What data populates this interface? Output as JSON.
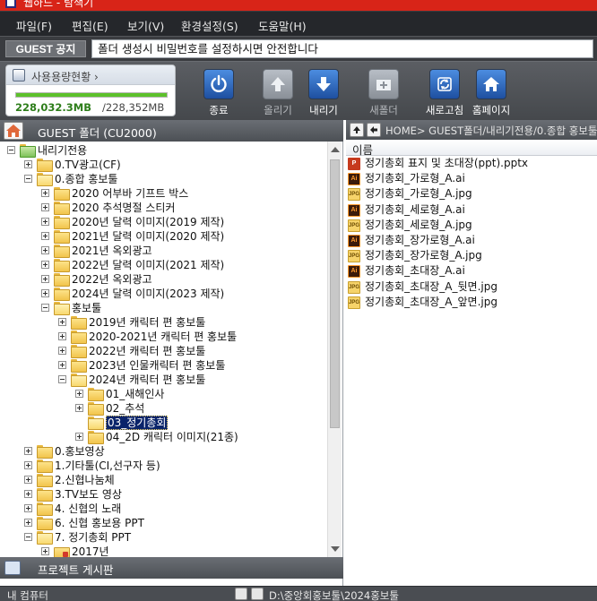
{
  "window": {
    "title": "웹하드 - 탐색기"
  },
  "menu": [
    "파일(F)",
    "편집(E)",
    "보기(V)",
    "환경설정(S)",
    "도움말(H)"
  ],
  "notice": {
    "badge": "GUEST 공지",
    "text": "폴더 생성시 비밀번호를 설정하시면 안전합니다"
  },
  "usage": {
    "title": "사용용량현황 ›",
    "used": "228,032.3MB",
    "total": "/228,352MB",
    "fraction": 0.9986
  },
  "toolbar": {
    "exit": "종료",
    "upload": "올리기",
    "download": "내리기",
    "new_folder": "새폴더",
    "refresh": "새로고침",
    "homepage": "홈페이지"
  },
  "left_panel": {
    "title": "GUEST 폴더 (CU2000)",
    "footer": "프로젝트 게시판"
  },
  "tree": [
    {
      "name": "내리기전용",
      "level": 0,
      "state": "open",
      "icon": "root"
    },
    {
      "name": "0.TV광고(CF)",
      "level": 1,
      "state": "closed"
    },
    {
      "name": "0.종합 홍보툴",
      "level": 1,
      "state": "open"
    },
    {
      "name": "2020 어부바 기프트 박스",
      "level": 2,
      "state": "closed"
    },
    {
      "name": "2020 추석명절 스티커",
      "level": 2,
      "state": "closed"
    },
    {
      "name": "2020년 달력 이미지(2019 제작)",
      "level": 2,
      "state": "closed"
    },
    {
      "name": "2021년 달력 이미지(2020 제작)",
      "level": 2,
      "state": "closed"
    },
    {
      "name": "2021년 옥외광고",
      "level": 2,
      "state": "closed"
    },
    {
      "name": "2022년 달력 이미지(2021 제작)",
      "level": 2,
      "state": "closed"
    },
    {
      "name": "2022년 옥외광고",
      "level": 2,
      "state": "closed"
    },
    {
      "name": "2024년 달력 이미지(2023 제작)",
      "level": 2,
      "state": "closed"
    },
    {
      "name": "홍보툴",
      "level": 2,
      "state": "open"
    },
    {
      "name": "2019년 캐릭터 편 홍보툴",
      "level": 3,
      "state": "closed"
    },
    {
      "name": "2020-2021년 캐릭터 편 홍보툴",
      "level": 3,
      "state": "closed"
    },
    {
      "name": "2022년 캐릭터 편 홍보툴",
      "level": 3,
      "state": "closed"
    },
    {
      "name": "2023년 인물캐릭터 편 홍보툴",
      "level": 3,
      "state": "closed"
    },
    {
      "name": "2024년 캐릭터 편 홍보툴",
      "level": 3,
      "state": "open"
    },
    {
      "name": "01_새해인사",
      "level": 4,
      "state": "closed"
    },
    {
      "name": "02_추석",
      "level": 4,
      "state": "closed"
    },
    {
      "name": "03_정기총회",
      "level": 4,
      "state": "leaf",
      "selected": true
    },
    {
      "name": "04_2D 캐릭터 이미지(21종)",
      "level": 4,
      "state": "closed"
    },
    {
      "name": "0.홍보영상",
      "level": 1,
      "state": "closed"
    },
    {
      "name": "1.기타툴(CI,선구자 등)",
      "level": 1,
      "state": "closed"
    },
    {
      "name": "2.신협나눔체",
      "level": 1,
      "state": "closed"
    },
    {
      "name": "3.TV보도 영상",
      "level": 1,
      "state": "closed"
    },
    {
      "name": "4. 신협의 노래",
      "level": 1,
      "state": "closed"
    },
    {
      "name": "6. 신협 홍보용 PPT",
      "level": 1,
      "state": "closed"
    },
    {
      "name": "7. 정기총회 PPT",
      "level": 1,
      "state": "open"
    },
    {
      "name": "2017년",
      "level": 2,
      "state": "closed",
      "icon": "locked"
    }
  ],
  "right_panel": {
    "path": "HOME> GUEST폴더/내리기전용/0.종합 홍보툴",
    "column_name": "이름"
  },
  "files": [
    {
      "name": "정기총회 표지 및 초대장(ppt).pptx",
      "type": "pptx",
      "icon_label": "P"
    },
    {
      "name": "정기총회_가로형_A.ai",
      "type": "ai",
      "icon_label": "Ai"
    },
    {
      "name": "정기총회_가로형_A.jpg",
      "type": "jpg",
      "icon_label": "JPG"
    },
    {
      "name": "정기총회_세로형_A.ai",
      "type": "ai",
      "icon_label": "Ai"
    },
    {
      "name": "정기총회_세로형_A.jpg",
      "type": "jpg",
      "icon_label": "JPG"
    },
    {
      "name": "정기총회_장가로형_A.ai",
      "type": "ai",
      "icon_label": "Ai"
    },
    {
      "name": "정기총회_장가로형_A.jpg",
      "type": "jpg",
      "icon_label": "JPG"
    },
    {
      "name": "정기총회_초대장_A.ai",
      "type": "ai",
      "icon_label": "Ai"
    },
    {
      "name": "정기총회_초대장_A_뒷면.jpg",
      "type": "jpg",
      "icon_label": "JPG"
    },
    {
      "name": "정기총회_초대장_A_앞면.jpg",
      "type": "jpg",
      "icon_label": "JPG"
    }
  ],
  "bottom": {
    "left": "내 컴퓨터",
    "right": "D:\\중앙회홍보툴\\2024홍보툴"
  },
  "colors": {
    "titlebar": "#d82418",
    "selection": "#0a246a",
    "usage_fill": "#5cc12a",
    "button_blue": "#2f6cc4"
  }
}
